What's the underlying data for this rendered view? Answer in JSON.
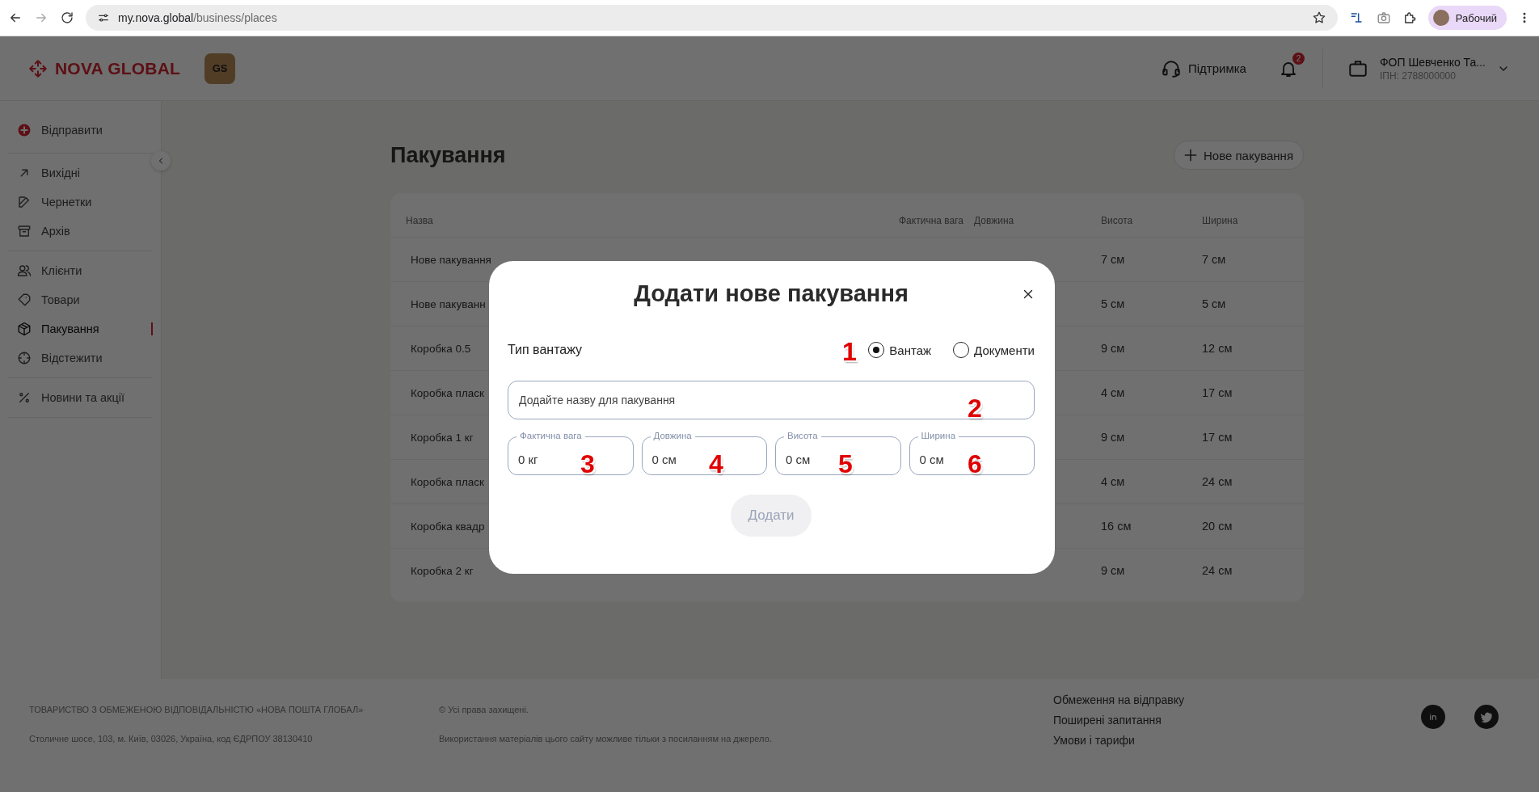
{
  "browser": {
    "url_host": "my.nova.global",
    "url_path": "/business/places",
    "profile": "Рабочий"
  },
  "header": {
    "logo": "NOVA GLOBAL",
    "badge": "GS",
    "support": "Підтримка",
    "notifications": "2",
    "account_name": "ФОП Шевченко Та...",
    "account_tax_id": "ІПН: 2788000000"
  },
  "sidebar": {
    "groups": [
      {
        "items": [
          {
            "label": "Відправити",
            "kind": "action",
            "selected": false
          }
        ]
      },
      {
        "items": [
          {
            "label": "Вихідні",
            "kind": "link",
            "selected": false
          },
          {
            "label": "Чернетки",
            "kind": "link",
            "selected": false
          },
          {
            "label": "Архів",
            "kind": "link",
            "selected": false
          }
        ]
      },
      {
        "items": [
          {
            "label": "Клієнти",
            "kind": "link",
            "selected": false
          },
          {
            "label": "Товари",
            "kind": "link",
            "selected": false
          },
          {
            "label": "Пакування",
            "kind": "link",
            "selected": true
          },
          {
            "label": "Відстежити",
            "kind": "link",
            "selected": false
          }
        ]
      },
      {
        "items": [
          {
            "label": "Новини та акції",
            "kind": "link",
            "selected": false
          }
        ]
      }
    ]
  },
  "page": {
    "title": "Пакування",
    "new_button": "Нове пакування"
  },
  "table": {
    "columns": [
      "Назва",
      "Фактична вага",
      "Довжина",
      "Висота",
      "Ширина"
    ],
    "rows": [
      {
        "name": "Нове пакування",
        "height": "7 см",
        "width": "7 см"
      },
      {
        "name": "Нове пакуванн",
        "height": "5 см",
        "width": "5 см"
      },
      {
        "name": "Коробка 0.5",
        "height": "9 см",
        "width": "12 см"
      },
      {
        "name": "Коробка пласк",
        "height": "4 см",
        "width": "17 см"
      },
      {
        "name": "Коробка 1 кг",
        "height": "9 см",
        "width": "17 см"
      },
      {
        "name": "Коробка пласк",
        "height": "4 см",
        "width": "24 см"
      },
      {
        "name": "Коробка квадр",
        "height": "16 см",
        "width": "20 см"
      },
      {
        "name": "Коробка 2 кг",
        "height": "9 см",
        "width": "24 см"
      }
    ]
  },
  "modal": {
    "title": "Додати нове пакування",
    "cargo_type": {
      "label": "Тип вантажу",
      "options": [
        {
          "label": "Вантаж",
          "selected": true
        },
        {
          "label": "Документи",
          "selected": false
        }
      ]
    },
    "name_field": {
      "placeholder": "Додайте назву для пакування"
    },
    "dimension_fields": [
      {
        "label": "Фактична вага",
        "value": "0 кг"
      },
      {
        "label": "Довжина",
        "value": "0 см"
      },
      {
        "label": "Висота",
        "value": "0 см"
      },
      {
        "label": "Ширина",
        "value": "0 см"
      }
    ],
    "submit": {
      "label": "Додати",
      "disabled": true
    },
    "callouts": [
      "1",
      "2",
      "3",
      "4",
      "5",
      "6"
    ]
  },
  "footer": {
    "company": "ТОВАРИСТВО З ОБМЕЖЕНОЮ ВІДПОВІДАЛЬНІСТЮ «НОВА ПОШТА ГЛОБАЛ»",
    "address": "Столичне шосе, 103, м. Київ, 03026, Україна, код ЄДРПОУ 38130410",
    "rights": "© Усі права захищені.",
    "notice": "Використання матеріалів цього сайту можливе тільки з посиланням на джерело.",
    "links": [
      "Обмеження на відправку",
      "Поширені запитання",
      "Умови і тарифи"
    ]
  }
}
